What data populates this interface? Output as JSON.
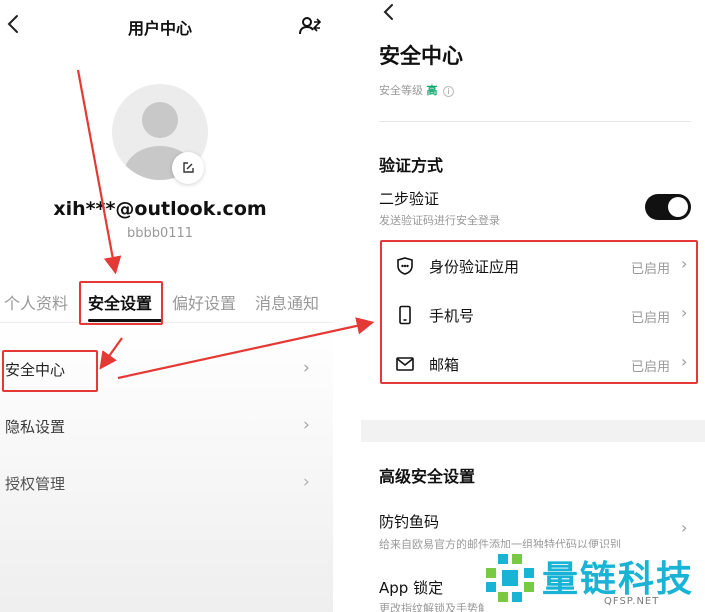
{
  "left": {
    "title": "用户中心",
    "back_icon": "chevron-left-icon",
    "switch_icon": "user-switch-icon",
    "profile": {
      "email": "xih***@outlook.com",
      "uid": "bbbb0111",
      "avatar_icon": "avatar-placeholder-icon",
      "edit_icon": "edit-icon"
    },
    "tabs": [
      {
        "label": "个人资料",
        "active": false
      },
      {
        "label": "安全设置",
        "active": true
      },
      {
        "label": "偏好设置",
        "active": false
      },
      {
        "label": "消息通知",
        "active": false
      }
    ],
    "menu": [
      {
        "label": "安全中心",
        "chevron": "›"
      },
      {
        "label": "隐私设置",
        "chevron": "›"
      },
      {
        "label": "授权管理",
        "chevron": "›"
      }
    ]
  },
  "right": {
    "back_icon": "chevron-left-icon",
    "title": "安全中心",
    "security_level_label": "安全等级",
    "security_level_value": "高",
    "info_icon": "info-icon",
    "verification": {
      "title": "验证方式",
      "two_step": {
        "label": "二步验证",
        "desc": "发送验证码进行安全登录",
        "enabled": true
      },
      "methods": [
        {
          "icon": "authenticator-shield-icon",
          "label": "身份验证应用",
          "status": "已启用",
          "chevron": "›"
        },
        {
          "icon": "phone-icon",
          "label": "手机号",
          "status": "已启用",
          "chevron": "›"
        },
        {
          "icon": "mail-icon",
          "label": "邮箱",
          "status": "已启用",
          "chevron": "›"
        }
      ]
    },
    "advanced": {
      "title": "高级安全设置",
      "items": [
        {
          "label": "防钓鱼码",
          "desc": "给来自欧易官方的邮件添加一组独特代码以便识别",
          "chevron": "›"
        },
        {
          "label": "App 锁定",
          "desc": "更改指纹解锁及手势解"
        }
      ]
    }
  },
  "watermark": {
    "text": "量链科技",
    "sub": "QFSP.NET"
  },
  "colors": {
    "highlight": "#e53935",
    "accent_green": "#19a974",
    "toggle_on": "#111111",
    "watermark": "#19b3d6"
  }
}
